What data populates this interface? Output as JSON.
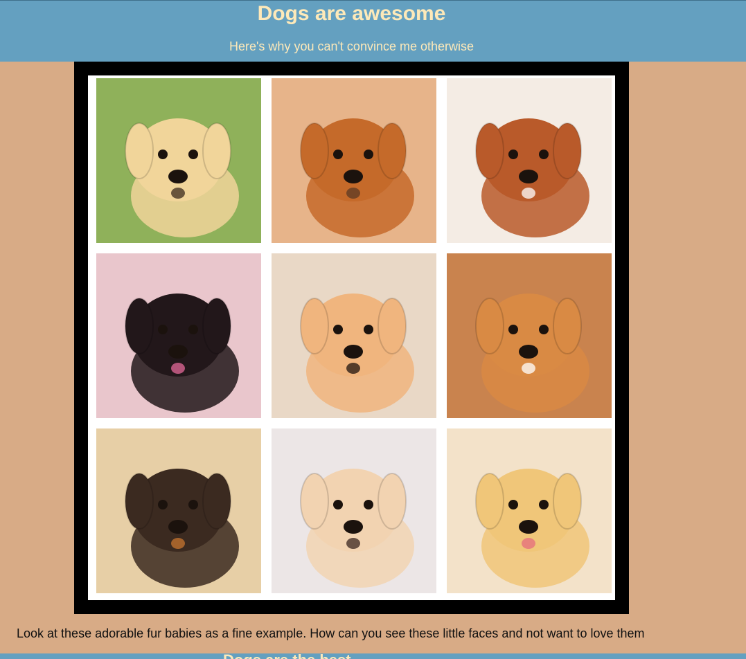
{
  "header": {
    "title": "Dogs are awesome",
    "subtitle": "Here's why you can't convince me otherwise"
  },
  "gallery": {
    "colors": {
      "frame": "#000000",
      "mat": "#ffffff"
    },
    "tiles": [
      {
        "icon": "golden-puppy-on-grass",
        "bg": "#8fb15a",
        "fur": "#f1d59a",
        "dark": "#3b2a1c"
      },
      {
        "icon": "orange-wrinkly-puppy",
        "bg": "#e7b48a",
        "fur": "#c56a2a",
        "dark": "#5a3a24"
      },
      {
        "icon": "sleeping-cavalier-puppy",
        "bg": "#f4ece4",
        "fur": "#b95a2a",
        "dark": "#ffffff"
      },
      {
        "icon": "black-pug-puppy",
        "bg": "#e9c6cc",
        "fur": "#22171a",
        "dark": "#e46a9a"
      },
      {
        "icon": "cream-puppy-lying",
        "bg": "#e9d8c6",
        "fur": "#f0b57e",
        "dark": "#20140f"
      },
      {
        "icon": "bulldog-puppy",
        "bg": "#c9834e",
        "fur": "#d98a44",
        "dark": "#ffffff"
      },
      {
        "icon": "rottweiler-puppy",
        "bg": "#e7cfa6",
        "fur": "#3b2a20",
        "dark": "#c8762f"
      },
      {
        "icon": "pekingese-puppy",
        "bg": "#ece6e6",
        "fur": "#f2d3b1",
        "dark": "#3a2620"
      },
      {
        "icon": "labrador-puppy",
        "bg": "#f3e2c9",
        "fur": "#f0c679",
        "dark": "#e56b7d"
      }
    ]
  },
  "caption": "Look at these adorable fur babies as a fine example. How can you see these little faces and not want to love them",
  "next_section": {
    "heading_fragment": "Dogs are the best"
  }
}
